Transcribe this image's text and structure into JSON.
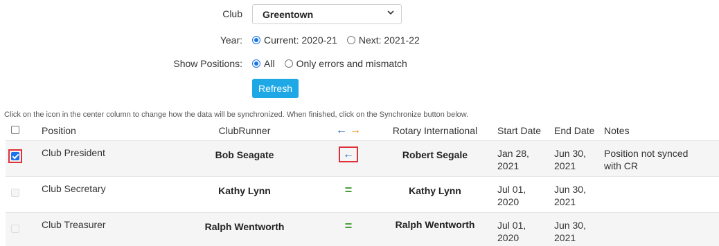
{
  "form": {
    "club_label": "Club",
    "club_value": "Greentown",
    "year_label": "Year:",
    "year_options": [
      {
        "label": "Current: 2020-21",
        "checked": true
      },
      {
        "label": "Next: 2021-22",
        "checked": false
      }
    ],
    "positions_label": "Show Positions:",
    "positions_options": [
      {
        "label": "All",
        "checked": true
      },
      {
        "label": "Only errors and mismatch",
        "checked": false
      }
    ],
    "refresh_label": "Refresh"
  },
  "instructions": "Click on the icon in the center column to change how the data will be synchronized. When finished, click on the Synchronize button below.",
  "table": {
    "headers": {
      "position": "Position",
      "clubrunner": "ClubRunner",
      "sync_left": "←",
      "sync_right": "→",
      "rotary": "Rotary International",
      "start_date": "Start Date",
      "end_date": "End Date",
      "notes": "Notes"
    },
    "rows": [
      {
        "position": "Club President",
        "clubrunner": "Bob Seagate",
        "sync": "←",
        "rotary": "Robert Segale",
        "start_line1": "Jan 28,",
        "start_line2": "2021",
        "end_line1": "Jun 30,",
        "end_line2": "2021",
        "notes_line1": "Position not synced",
        "notes_line2": "with CR"
      },
      {
        "position": "Club Secretary",
        "clubrunner": "Kathy Lynn",
        "sync": "=",
        "rotary": "Kathy Lynn",
        "start_line1": "Jul 01,",
        "start_line2": "2020",
        "end_line1": "Jun 30,",
        "end_line2": "2021",
        "notes_line1": "",
        "notes_line2": ""
      },
      {
        "position": "Club Treasurer",
        "clubrunner": "Ralph Wentworth",
        "sync": "=",
        "rotary": "Ralph Wentworth",
        "start_line1": "Jul 01,",
        "start_line2": "2020",
        "end_line1": "Jun 30,",
        "end_line2": "2021",
        "notes_line1": "",
        "notes_line2": ""
      }
    ]
  }
}
